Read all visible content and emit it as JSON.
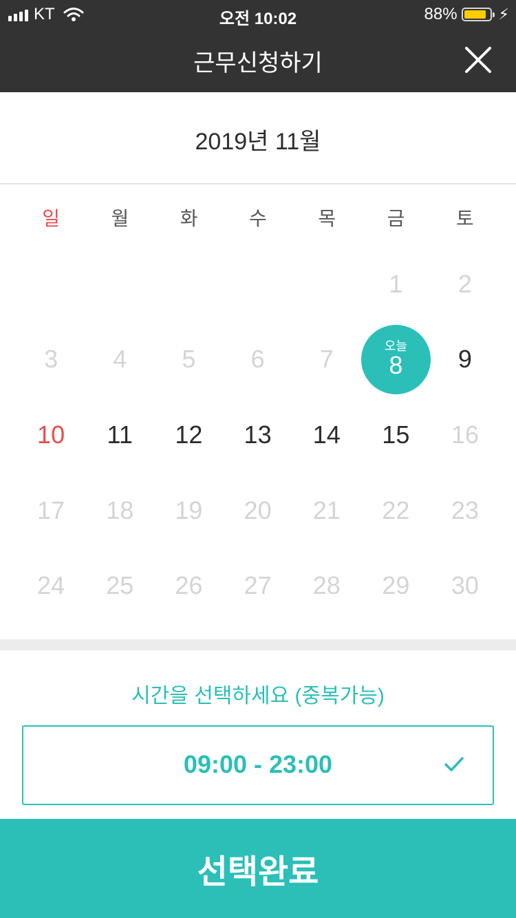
{
  "status_bar": {
    "carrier": "KT",
    "time": "오전 10:02",
    "battery": "88%",
    "battery_level": 0.88
  },
  "header": {
    "title": "근무신청하기"
  },
  "calendar": {
    "month_label": "2019년 11월",
    "weekdays": [
      "일",
      "월",
      "화",
      "수",
      "목",
      "금",
      "토"
    ],
    "leading_blanks": 5,
    "today_label": "오늘",
    "days": [
      {
        "n": "1",
        "state": "dim"
      },
      {
        "n": "2",
        "state": "dim"
      },
      {
        "n": "3",
        "state": "dim"
      },
      {
        "n": "4",
        "state": "dim"
      },
      {
        "n": "5",
        "state": "dim"
      },
      {
        "n": "6",
        "state": "dim"
      },
      {
        "n": "7",
        "state": "dim"
      },
      {
        "n": "8",
        "state": "today"
      },
      {
        "n": "9",
        "state": "active"
      },
      {
        "n": "10",
        "state": "sunday"
      },
      {
        "n": "11",
        "state": "active"
      },
      {
        "n": "12",
        "state": "active"
      },
      {
        "n": "13",
        "state": "active"
      },
      {
        "n": "14",
        "state": "active"
      },
      {
        "n": "15",
        "state": "active"
      },
      {
        "n": "16",
        "state": "dim"
      },
      {
        "n": "17",
        "state": "dim"
      },
      {
        "n": "18",
        "state": "dim"
      },
      {
        "n": "19",
        "state": "dim"
      },
      {
        "n": "20",
        "state": "dim"
      },
      {
        "n": "21",
        "state": "dim"
      },
      {
        "n": "22",
        "state": "dim"
      },
      {
        "n": "23",
        "state": "dim"
      },
      {
        "n": "24",
        "state": "dim"
      },
      {
        "n": "25",
        "state": "dim"
      },
      {
        "n": "26",
        "state": "dim"
      },
      {
        "n": "27",
        "state": "dim"
      },
      {
        "n": "28",
        "state": "dim"
      },
      {
        "n": "29",
        "state": "dim"
      },
      {
        "n": "30",
        "state": "dim"
      }
    ]
  },
  "time_select": {
    "prompt": "시간을 선택하세요 (중복가능)",
    "slots": [
      {
        "range": "09:00 - 23:00",
        "selected": true
      }
    ]
  },
  "submit": {
    "label": "선택완료"
  },
  "colors": {
    "accent": "#2bbfb8",
    "sunday": "#ee4b4b",
    "dim": "#d4d4d4",
    "header_bg": "#333333",
    "battery": "#ffcc00"
  }
}
